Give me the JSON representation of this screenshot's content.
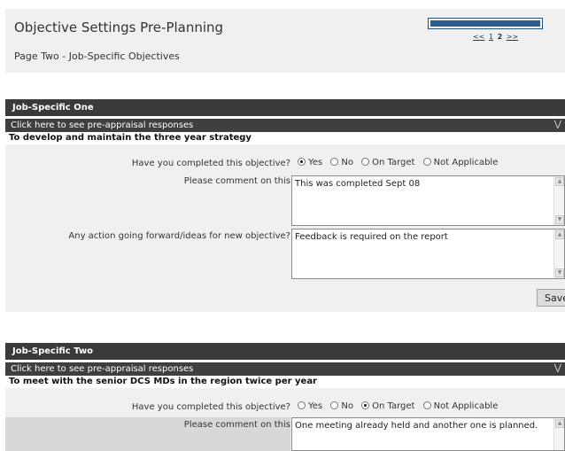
{
  "header": {
    "title": "Objective Settings Pre-Planning",
    "subtitle": "Page Two - Job-Specific Objectives",
    "progress_fraction": 1.0,
    "pager": {
      "prev": "<<",
      "page1": "1",
      "page2": "2",
      "next": ">>"
    }
  },
  "sections": [
    {
      "header": "Job-Specific One",
      "pre_appraisal_link": "Click here to see pre-appraisal responses",
      "objective": "To develop and maintain the three year strategy",
      "completed_question": "Have you completed this objective?",
      "options": [
        "Yes",
        "No",
        "On Target",
        "Not Applicable"
      ],
      "selected": "Yes",
      "comment_label": "Please comment on this",
      "comment_value": "This was completed Sept 08",
      "action_label": "Any action going forward/ideas for new objective?",
      "action_value": "Feedback is required on the report",
      "save_label": "Save"
    },
    {
      "header": "Job-Specific Two",
      "pre_appraisal_link": "Click here to see pre-appraisal responses",
      "objective": "To meet with the senior DCS MDs in the region twice per year",
      "completed_question": "Have you completed this objective?",
      "options": [
        "Yes",
        "No",
        "On Target",
        "Not Applicable"
      ],
      "selected": "On Target",
      "comment_label": "Please comment on this",
      "comment_value": "One meeting already held and another one is planned."
    }
  ],
  "icons": {
    "expand": "double-chevron-down-icon",
    "scroll_up": "scroll-up-arrow-icon",
    "scroll_down": "scroll-down-arrow-icon"
  }
}
